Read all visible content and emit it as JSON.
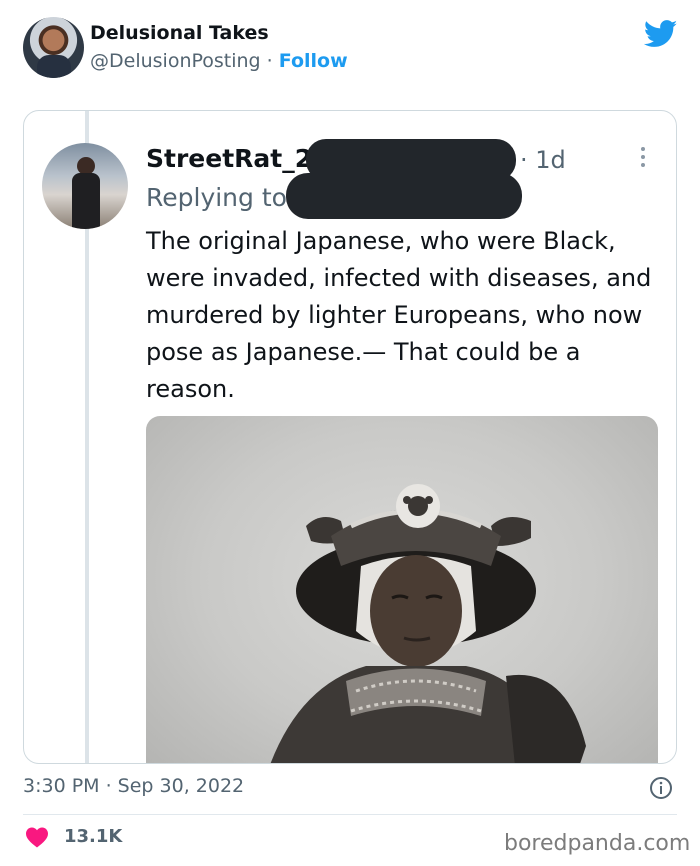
{
  "author": {
    "name": "Delusional Takes",
    "handle": "@DelusionPosting",
    "separator": " · ",
    "follow_label": "Follow",
    "avatar_icon": "profile-avatar",
    "platform_icon": "twitter-bird-icon",
    "brand_color": "#1d9bf0"
  },
  "quoted_tweet": {
    "name": "StreetRat_2",
    "time": "· 1d",
    "replying_label": "Replying to",
    "text": "The original Japanese, who were Black, were invaded, infected with diseases, and murdered by lighter Europeans, who now pose as Japanese.— That could be a reason.",
    "more_icon": "more-options-icon",
    "redaction_color": "#22262b"
  },
  "meta": {
    "timestamp": "3:30 PM · Sep 30, 2022",
    "like_count": "13.1K",
    "like_icon": "heart-icon",
    "info_icon": "info-icon",
    "like_color": "#f91880"
  },
  "watermark": "boredpanda.com"
}
